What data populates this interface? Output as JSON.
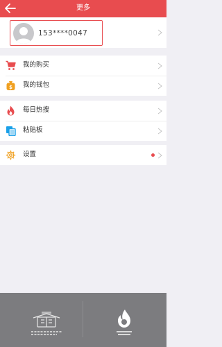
{
  "header": {
    "title": "更多"
  },
  "account": {
    "id": "153****0047"
  },
  "groups": [
    {
      "items": [
        {
          "label": "我的购买",
          "icon": "cart-icon"
        },
        {
          "label": "我的钱包",
          "icon": "wallet-icon"
        }
      ]
    },
    {
      "items": [
        {
          "label": "每日热搜",
          "icon": "fire-icon"
        },
        {
          "label": "粘贴板",
          "icon": "clipboard-icon"
        }
      ]
    },
    {
      "items": [
        {
          "label": "设置",
          "icon": "gear-icon",
          "badge": true
        }
      ]
    }
  ],
  "colors": {
    "accent": "#e84c4f",
    "footer": "#7c7c7f",
    "background": "#f0eff4"
  },
  "footer": {
    "left_logo": "publisher-logo",
    "right_logo": "app-logo"
  }
}
